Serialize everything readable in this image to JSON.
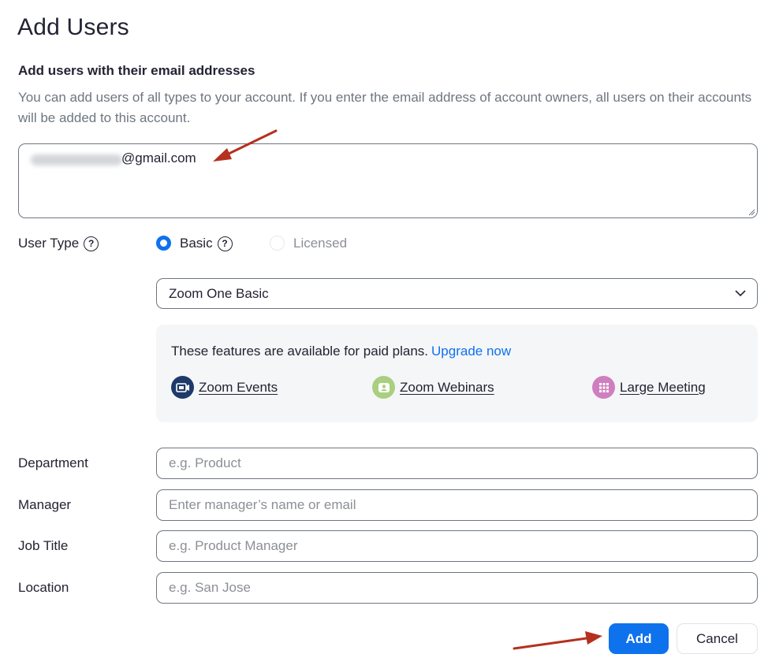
{
  "page": {
    "title": "Add Users",
    "subtitle": "Add users with their email addresses",
    "description": "You can add users of all types to your account. If you enter the email address of account owners, all users on their accounts will be added to this account."
  },
  "email_input": {
    "value_visible": "@gmail.com",
    "note": "local part blurred"
  },
  "user_type": {
    "label": "User Type",
    "help_glyph": "?",
    "options": [
      {
        "label": "Basic",
        "selected": true,
        "has_help": true
      },
      {
        "label": "Licensed",
        "selected": false,
        "disabled": true
      }
    ]
  },
  "plan_select": {
    "value": "Zoom One Basic"
  },
  "features_panel": {
    "text": "These features are available for paid plans.",
    "link_label": "Upgrade now",
    "items": [
      {
        "label": "Zoom Events",
        "icon": "zoom-events-icon",
        "color": "#1e3a6b"
      },
      {
        "label": "Zoom Webinars",
        "icon": "zoom-webinars-icon",
        "color": "#a9cf7f"
      },
      {
        "label": "Large Meeting",
        "icon": "large-meeting-icon",
        "color": "#cf7fbf"
      }
    ]
  },
  "fields": [
    {
      "label": "Department",
      "placeholder": "e.g. Product"
    },
    {
      "label": "Manager",
      "placeholder": "Enter manager’s name or email"
    },
    {
      "label": "Job Title",
      "placeholder": "e.g. Product Manager"
    },
    {
      "label": "Location",
      "placeholder": "e.g. San Jose"
    }
  ],
  "actions": {
    "add_label": "Add",
    "cancel_label": "Cancel"
  },
  "colors": {
    "accent": "#0e72ed",
    "annotation_arrow": "#b5301f",
    "text": "#232333",
    "muted": "#6e7680"
  }
}
